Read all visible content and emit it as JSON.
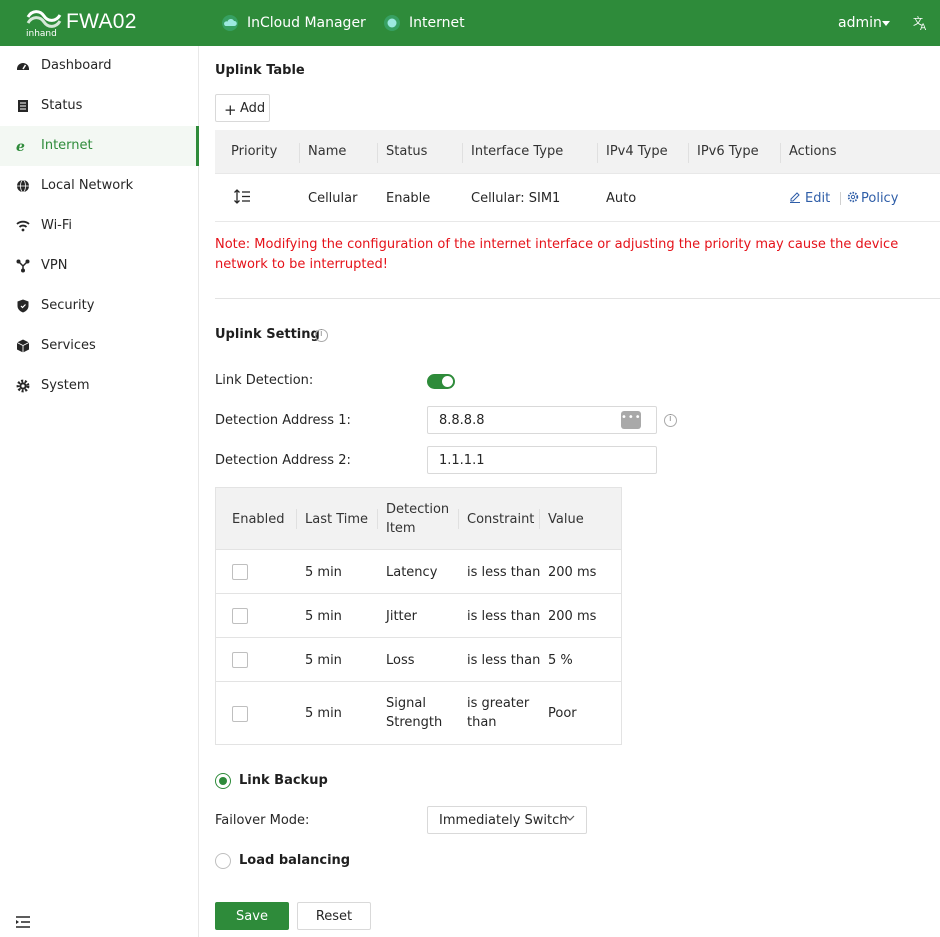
{
  "header": {
    "logo_text": "inhand",
    "brand": "FWA02",
    "nav": [
      {
        "label": "InCloud Manager",
        "icon": "cloud-icon"
      },
      {
        "label": "Internet",
        "icon": "status-dot-icon"
      }
    ],
    "user": "admin",
    "lang_icon": "translate-icon"
  },
  "sidebar": {
    "items": [
      {
        "label": "Dashboard",
        "icon": "dashboard-icon"
      },
      {
        "label": "Status",
        "icon": "list-icon"
      },
      {
        "label": "Internet",
        "icon": "internet-explorer-icon",
        "active": true
      },
      {
        "label": "Local Network",
        "icon": "globe-icon"
      },
      {
        "label": "Wi-Fi",
        "icon": "wifi-icon"
      },
      {
        "label": "VPN",
        "icon": "vpn-icon"
      },
      {
        "label": "Security",
        "icon": "shield-icon"
      },
      {
        "label": "Services",
        "icon": "cube-icon"
      },
      {
        "label": "System",
        "icon": "gear-icon"
      }
    ]
  },
  "uplink_table": {
    "title": "Uplink Table",
    "add_label": "Add",
    "columns": [
      "Priority",
      "Name",
      "Status",
      "Interface Type",
      "IPv4 Type",
      "IPv6 Type",
      "Actions"
    ],
    "rows": [
      {
        "name": "Cellular",
        "status": "Enable",
        "interface_type": "Cellular: SIM1",
        "ipv4_type": "Auto",
        "ipv6_type": "",
        "edit": "Edit",
        "policy": "Policy"
      }
    ],
    "note": "Note: Modifying the configuration of the internet interface or adjusting the priority may cause the device network to be interrupted!"
  },
  "uplink_setting": {
    "title": "Uplink Setting",
    "link_detection_label": "Link Detection:",
    "link_detection_on": true,
    "addr1_label": "Detection Address 1:",
    "addr1_value": "8.8.8.8",
    "addr2_label": "Detection Address 2:",
    "addr2_value": "1.1.1.1",
    "detection_table": {
      "columns": [
        "Enabled",
        "Last Time",
        "Detection Item",
        "Constraint",
        "Value"
      ],
      "rows": [
        {
          "enabled": false,
          "last_time": "5 min",
          "item": "Latency",
          "constraint": "is less than",
          "value": "200 ms"
        },
        {
          "enabled": false,
          "last_time": "5 min",
          "item": "Jitter",
          "constraint": "is less than",
          "value": "200 ms"
        },
        {
          "enabled": false,
          "last_time": "5 min",
          "item": "Loss",
          "constraint": "is less than",
          "value": "5 %"
        },
        {
          "enabled": false,
          "last_time": "5 min",
          "item": "Signal Strength",
          "constraint": "is greater than",
          "value": "Poor"
        }
      ]
    },
    "link_backup_label": "Link Backup",
    "failover_label": "Failover Mode:",
    "failover_value": "Immediately Switch",
    "load_balancing_label": "Load balancing",
    "mode": "link_backup"
  },
  "actions": {
    "save": "Save",
    "reset": "Reset"
  },
  "colors": {
    "brand_green": "#2e8b3a",
    "note_red": "#e5121a",
    "link_blue": "#2f5ea8"
  }
}
